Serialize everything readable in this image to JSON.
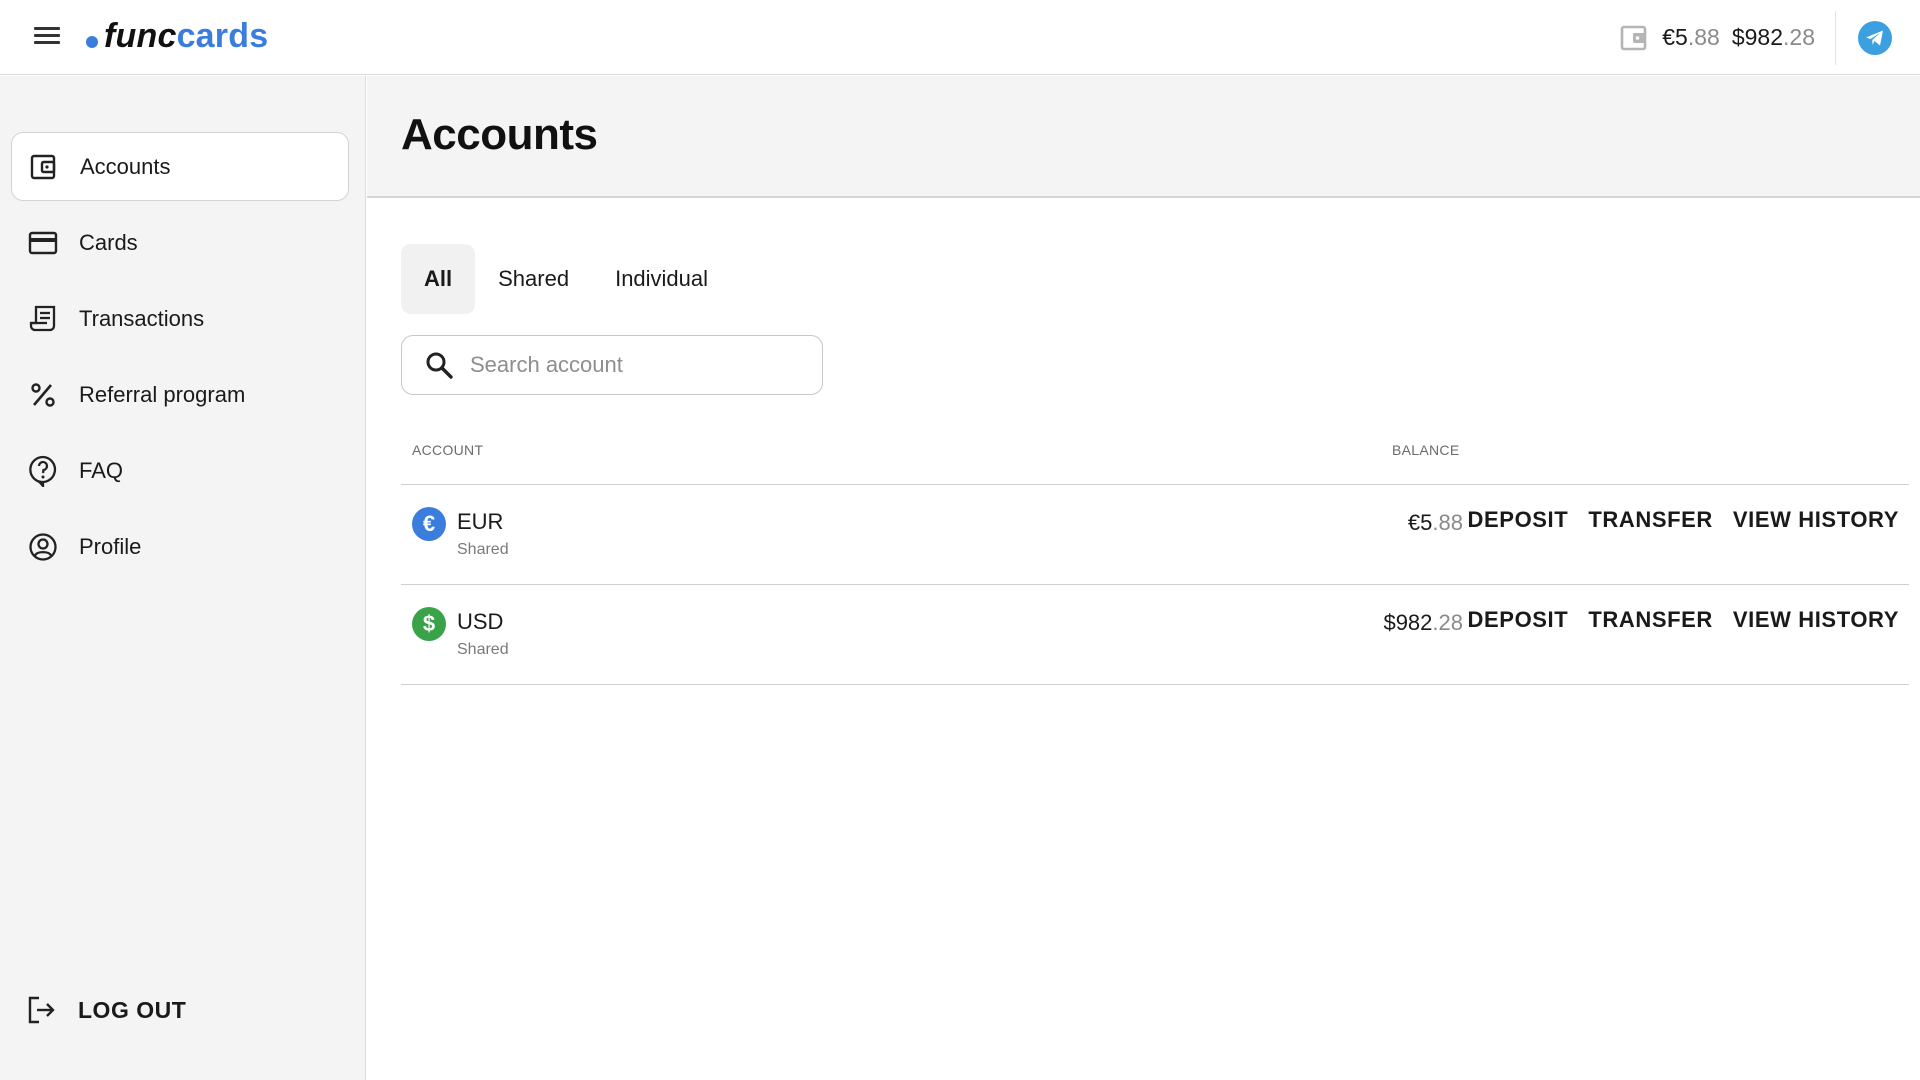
{
  "header": {
    "logo_part1": "func",
    "logo_part2": "cards",
    "brand_color": "#3b7ddd",
    "balances": [
      {
        "int": "€5",
        "dec": ".88"
      },
      {
        "int": "$982",
        "dec": ".28"
      }
    ],
    "telegram_color": "#3b9fe0"
  },
  "sidebar": {
    "items": [
      {
        "label": "Accounts",
        "icon": "wallet-icon",
        "active": true
      },
      {
        "label": "Cards",
        "icon": "credit-card-icon"
      },
      {
        "label": "Transactions",
        "icon": "receipt-icon"
      },
      {
        "label": "Referral program",
        "icon": "percent-icon"
      },
      {
        "label": "FAQ",
        "icon": "help-bubble-icon"
      },
      {
        "label": "Profile",
        "icon": "user-circle-icon"
      }
    ],
    "logout_label": "LOG OUT"
  },
  "main": {
    "title": "Accounts",
    "tabs": [
      {
        "label": "All",
        "active": true
      },
      {
        "label": "Shared"
      },
      {
        "label": "Individual"
      }
    ],
    "search": {
      "placeholder": "Search account",
      "value": ""
    },
    "table": {
      "headers": {
        "account": "ACCOUNT",
        "balance": "BALANCE"
      },
      "rows": [
        {
          "code": "EUR",
          "type": "Shared",
          "symbol": "€",
          "icon_color": "#3b7ddd",
          "balance_int": "€5",
          "balance_dec": ".88",
          "actions": [
            "DEPOSIT",
            "TRANSFER",
            "VIEW HISTORY"
          ]
        },
        {
          "code": "USD",
          "type": "Shared",
          "symbol": "$",
          "icon_color": "#3aa34a",
          "balance_int": "$982",
          "balance_dec": ".28",
          "actions": [
            "DEPOSIT",
            "TRANSFER",
            "VIEW HISTORY"
          ]
        }
      ]
    }
  }
}
